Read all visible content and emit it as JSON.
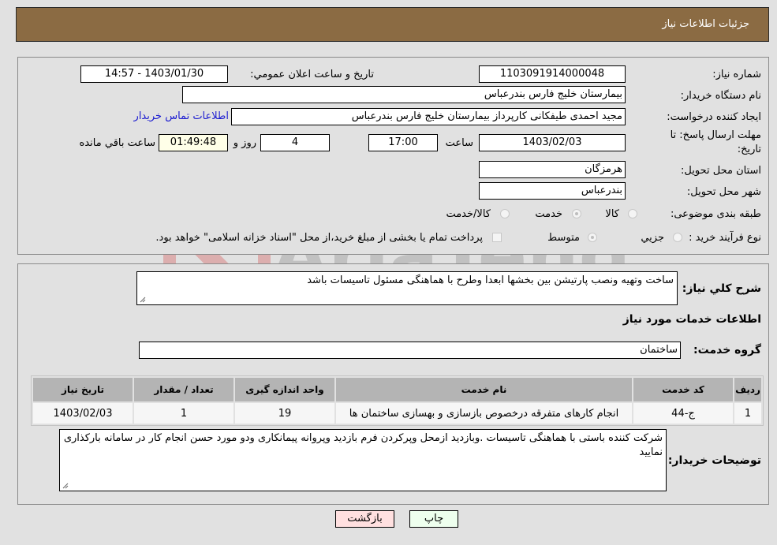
{
  "header": {
    "title": "جزئیات اطلاعات نیاز"
  },
  "details": {
    "need_number_label": "شماره نیاز:",
    "need_number": "1103091914000048",
    "announce_label": "تاریخ و ساعت اعلان عمومي:",
    "announce_value": "1403/01/30 - 14:57",
    "buyer_org_label": "نام دستگاه خریدار:",
    "buyer_org": "بیمارستان خلیج فارس بندرعباس",
    "creator_label": "ایجاد کننده درخواست:",
    "creator": "مجید احمدی طیفکانی کارپرداز بیمارستان خلیج فارس بندرعباس",
    "buyer_contact_link": "اطلاعات تماس خریدار",
    "deadline_label_line1": "مهلت ارسال پاسخ: تا",
    "deadline_label_line2": "تاریخ:",
    "deadline_date": "1403/02/03",
    "time_label": "ساعت",
    "deadline_time": "17:00",
    "days_value": "4",
    "days_label": "روز و",
    "remaining_time": "01:49:48",
    "remaining_label": "ساعت باقي مانده",
    "province_label": "استان محل تحویل:",
    "province": "هرمزگان",
    "city_label": "شهر محل تحویل:",
    "city": "بندرعباس",
    "category_label": "طبقه بندی موضوعی:",
    "category_options": [
      {
        "label": "کالا",
        "checked": false
      },
      {
        "label": "خدمت",
        "checked": true
      },
      {
        "label": "کالا/خدمت",
        "checked": false
      }
    ],
    "process_label": "نوع فرآیند خرید :",
    "process_options": [
      {
        "label": "جزيي",
        "checked": false
      },
      {
        "label": "متوسط",
        "checked": true
      }
    ],
    "treasury_checkbox_label": "پرداخت تمام یا بخشی از مبلغ خرید،از محل \"اسناد خزانه اسلامی\" خواهد بود."
  },
  "description": {
    "label": "شرح كلي نیاز:",
    "value": "ساخت وتهیه ونصب پارتیشن بین بخشها ابعدا وطرح با هماهنگی مسئول تاسیسات باشد"
  },
  "services": {
    "section_title": "اطلاعات خدمات مورد نیاز",
    "group_label": "گروه خدمت:",
    "group_value": "ساختمان",
    "columns": [
      "ردیف",
      "کد خدمت",
      "نام خدمت",
      "واحد اندازه گیری",
      "تعداد / مقدار",
      "تاریخ نیاز"
    ],
    "rows": [
      [
        "1",
        "ج-44",
        "انجام کارهای متفرقه درخصوص بازسازی و بهسازی ساختمان ها",
        "19",
        "1",
        "1403/02/03"
      ]
    ]
  },
  "buyer_notes": {
    "label": "توضیحات خریدار:",
    "value": "شرکت کننده باستی با هماهنگی تاسیسات .وبازدید ازمحل وپرکردن فرم بازدید وپروانه پیمانکاری ودو مورد حسن انجام کار در سامانه بارکذاری نمایید"
  },
  "buttons": {
    "print": "چاپ",
    "back": "بازگشت"
  },
  "watermark": {
    "text": "AriaTender.neT"
  },
  "colors": {
    "header_bg": "#8b6b43",
    "print_bg": "#eeffee",
    "back_bg": "#ffe0e0",
    "link": "#1a1ad0"
  }
}
